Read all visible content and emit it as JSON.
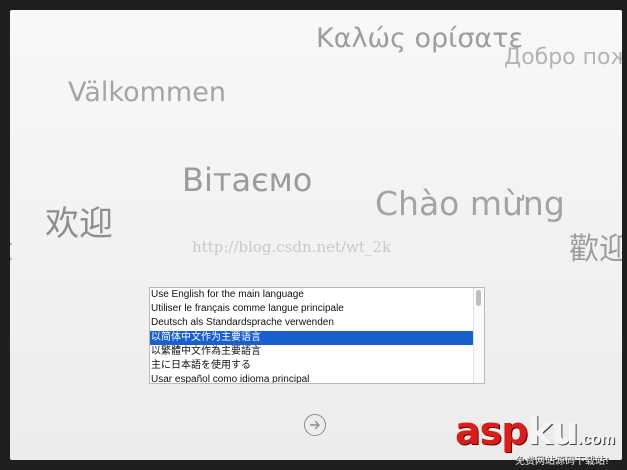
{
  "greetings": {
    "greek": "Καλώς ορίσατε",
    "russian": "Добро пож",
    "swedish": "Välkommen",
    "ukrainian": "Вітаємо",
    "vietnamese": "Chào mừng",
    "chinese_simplified": "欢迎",
    "chinese_traditional": "歡迎",
    "partial_left": "t"
  },
  "watermark": "http://blog.csdn.net/wt_2k",
  "language_list": {
    "items": [
      "Use English for the main language",
      "Utiliser le français comme langue principale",
      "Deutsch als Standardsprache verwenden",
      "以简体中文作为主要语言",
      "以繁體中文作為主要語言",
      "主に日本語を使用する",
      "Usar español como idioma principal"
    ],
    "selected_index": 3
  },
  "next_button": {
    "icon": "arrow-right-circle-icon"
  },
  "brand": {
    "part1": "asp",
    "part2": "ku",
    "tld": ".com",
    "subtitle": "免费网站源码下载站!"
  },
  "colors": {
    "selection": "#1a5fd0",
    "brand_red": "#d81d1d"
  }
}
